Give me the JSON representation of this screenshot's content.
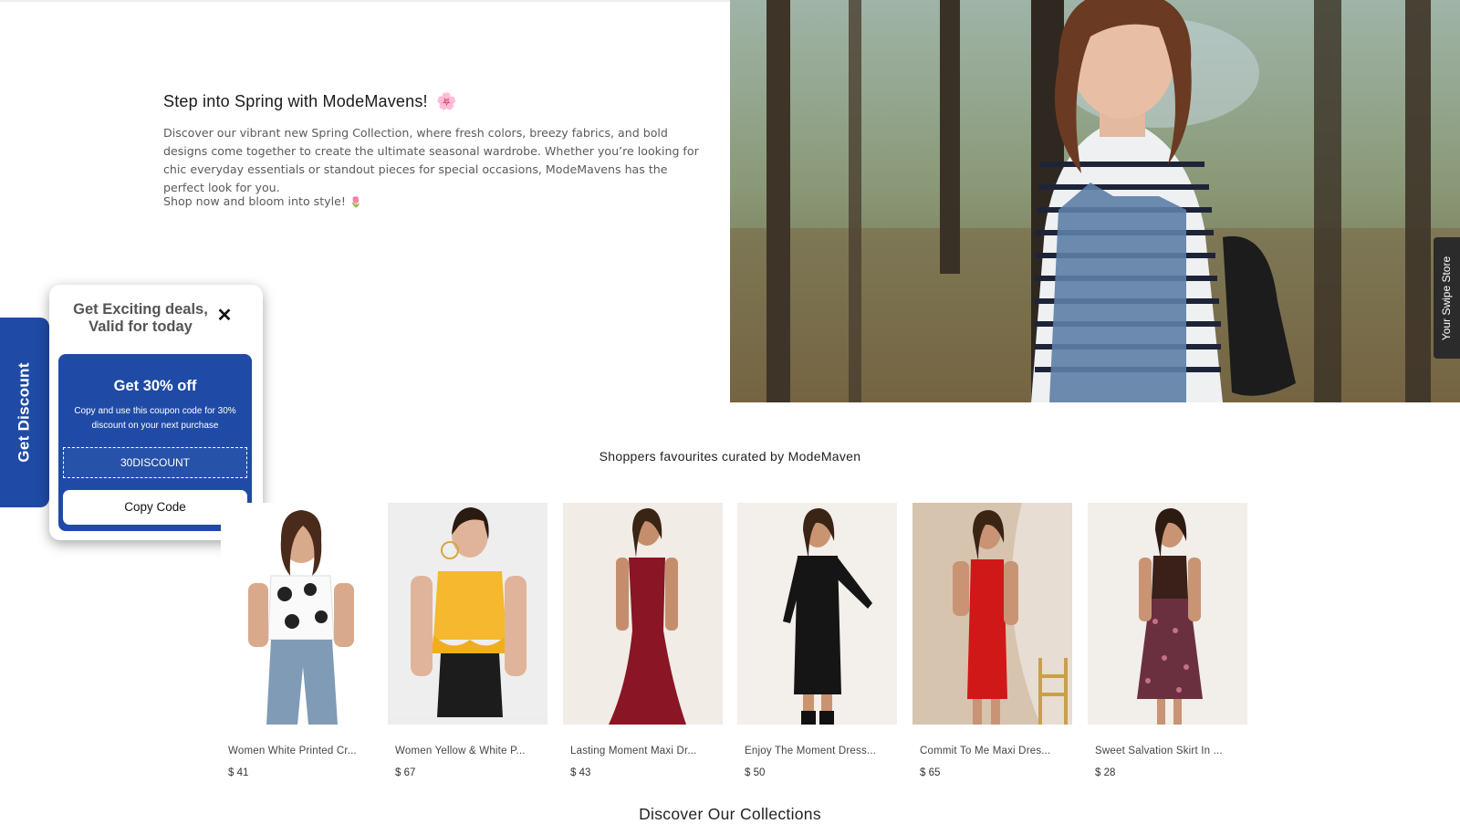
{
  "hero": {
    "title": "Step into Spring with ModeMavens!",
    "title_emoji": "🌸",
    "body": "Discover our vibrant new Spring Collection, where fresh colors, breezy fabrics, and bold designs come together to create the ultimate seasonal wardrobe. Whether you’re looking for chic everyday essentials or standout pieces for special occasions, ModeMavens has the perfect look for you.",
    "cta": "Shop now and bloom into style!",
    "cta_emoji": "🌷"
  },
  "swipe_tab": {
    "label": "Your Swipe Store"
  },
  "discount_tab": {
    "label": "Get Discount"
  },
  "popup": {
    "heading_line1": "Get Exciting deals,",
    "heading_line2": "Valid for today",
    "close_glyph": "✕",
    "offer_title": "Get 30% off",
    "offer_desc": "Copy and use this coupon code for 30% discount on your next purchase",
    "coupon_code": "30DISCOUNT",
    "copy_label": "Copy Code"
  },
  "favourites": {
    "title": "Shoppers favourites curated by ModeMaven",
    "products": [
      {
        "name": "Women White Printed Cr...",
        "price": "$ 41",
        "icon": "white-printed-crop-top"
      },
      {
        "name": "Women Yellow & White P...",
        "price": "$ 67",
        "icon": "yellow-peplum-top"
      },
      {
        "name": "Lasting Moment Maxi Dr...",
        "price": "$ 43",
        "icon": "maroon-maxi-dress"
      },
      {
        "name": "Enjoy The Moment Dress...",
        "price": "$ 50",
        "icon": "black-slit-dress"
      },
      {
        "name": "Commit To Me Maxi Dres...",
        "price": "$ 65",
        "icon": "red-midi-dress"
      },
      {
        "name": "Sweet Salvation Skirt In ...",
        "price": "$ 28",
        "icon": "floral-skirt-outfit"
      }
    ]
  },
  "collections": {
    "title": "Discover Our Collections"
  },
  "colors": {
    "accent": "#1f4ba6",
    "dark_tab": "#2b2b2b"
  }
}
